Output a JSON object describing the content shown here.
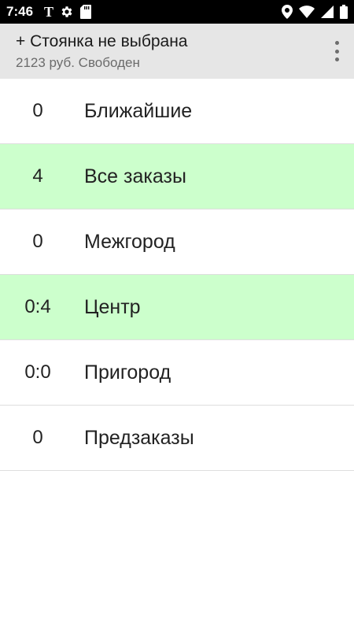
{
  "status_bar": {
    "time": "7:46",
    "left_icons": [
      "t-icon",
      "gear-icon",
      "sd-card-icon"
    ],
    "right_icons": [
      "location-icon",
      "wifi-icon",
      "signal-icon",
      "battery-icon"
    ]
  },
  "app_bar": {
    "title": "+ Стоянка не выбрана",
    "subtitle": "2123 руб. Свободен",
    "background": "#e6e6e6"
  },
  "list": {
    "highlight_color": "#ccffcc",
    "items": [
      {
        "count": "0",
        "label": "Ближайшие",
        "highlighted": false
      },
      {
        "count": "4",
        "label": "Все заказы",
        "highlighted": true
      },
      {
        "count": "0",
        "label": "Межгород",
        "highlighted": false
      },
      {
        "count": "0:4",
        "label": "Центр",
        "highlighted": true
      },
      {
        "count": "0:0",
        "label": "Пригород",
        "highlighted": false
      },
      {
        "count": "0",
        "label": "Предзаказы",
        "highlighted": false
      }
    ]
  }
}
